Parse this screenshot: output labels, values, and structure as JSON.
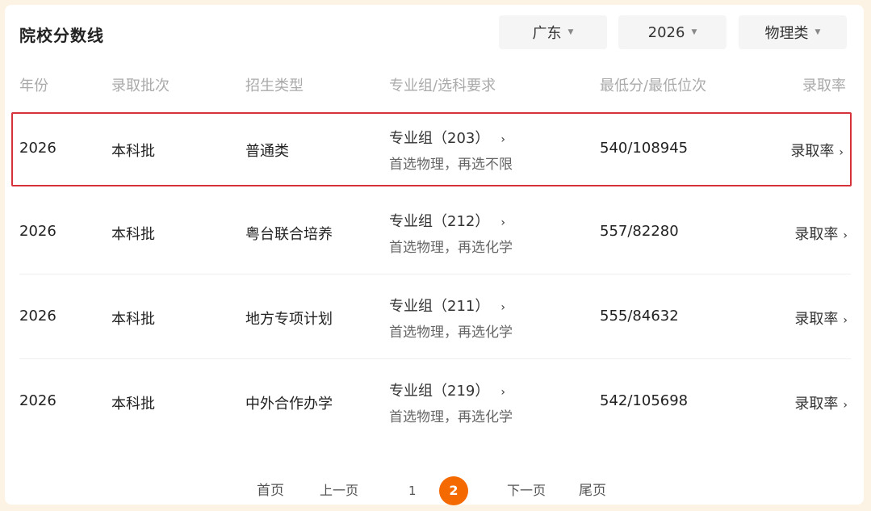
{
  "title": "院校分数线",
  "filters": {
    "province": "广东",
    "year": "2026",
    "subject": "物理类"
  },
  "columns": {
    "year": "年份",
    "batch": "录取批次",
    "type": "招生类型",
    "group": "专业组/选科要求",
    "score": "最低分/最低位次",
    "rate": "录取率"
  },
  "rows": [
    {
      "year": "2026",
      "batch": "本科批",
      "type": "普通类",
      "group": "专业组（203）",
      "requirement": "首选物理，再选不限",
      "score": "540/108945",
      "rate": "录取率"
    },
    {
      "year": "2026",
      "batch": "本科批",
      "type": "粤台联合培养",
      "group": "专业组（212）",
      "requirement": "首选物理，再选化学",
      "score": "557/82280",
      "rate": "录取率"
    },
    {
      "year": "2026",
      "batch": "本科批",
      "type": "地方专项计划",
      "group": "专业组（211）",
      "requirement": "首选物理，再选化学",
      "score": "555/84632",
      "rate": "录取率"
    },
    {
      "year": "2026",
      "batch": "本科批",
      "type": "中外合作办学",
      "group": "专业组（219）",
      "requirement": "首选物理，再选化学",
      "score": "542/105698",
      "rate": "录取率"
    }
  ],
  "pagination": {
    "first": "首页",
    "prev": "上一页",
    "page1": "1",
    "page2": "2",
    "next": "下一页",
    "last": "尾页"
  },
  "colors": {
    "accent": "#f56a00",
    "highlight_border": "#d5323c"
  },
  "icons": {
    "caret": "caret-down-icon",
    "chevron": "chevron-right-icon"
  }
}
